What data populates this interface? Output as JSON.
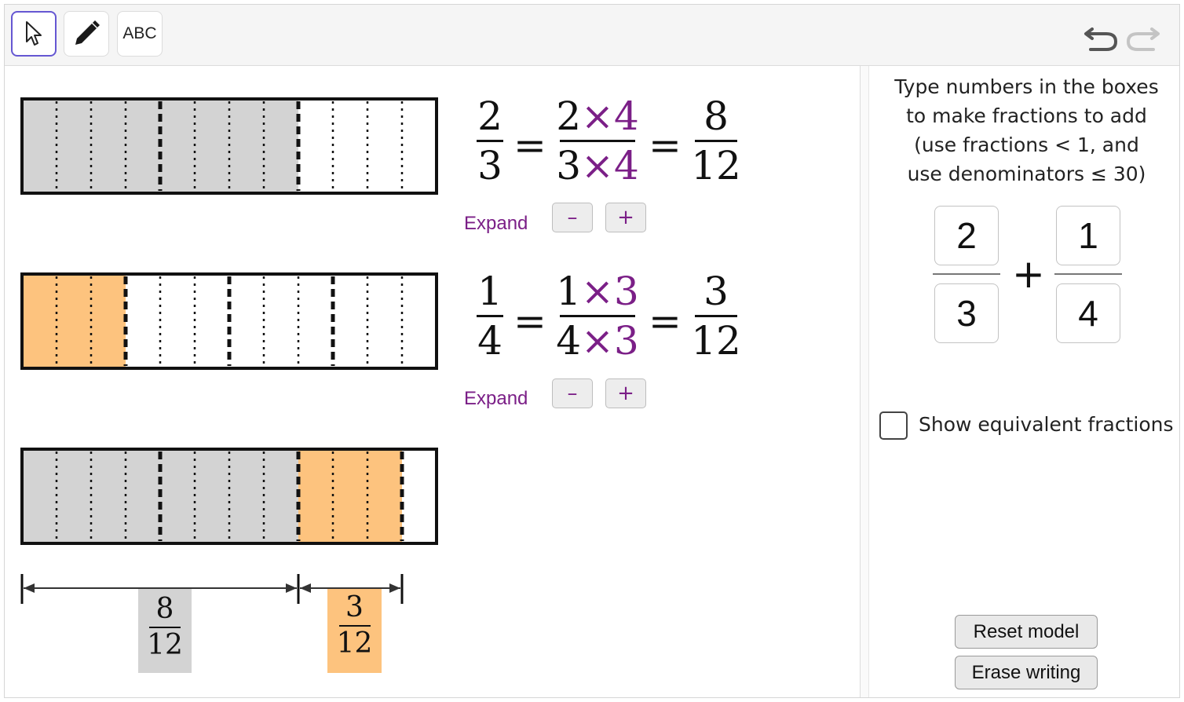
{
  "toolbar": {
    "tools": [
      {
        "icon": "arrow-cursor-icon",
        "active": true
      },
      {
        "icon": "pencil-icon",
        "active": false
      },
      {
        "text": "ABC"
      }
    ],
    "undo_icon": "undo-icon",
    "redo_icon": "redo-icon"
  },
  "model": {
    "colors": {
      "first": "#d3d3d3",
      "second": "#fdc37e",
      "accent": "#7b1f87"
    },
    "bar1": {
      "parts": 12,
      "filled": 8,
      "major_divisions": 3
    },
    "bar2": {
      "parts": 12,
      "filled": 3,
      "major_divisions": 4
    },
    "bar3": {
      "parts": 12,
      "first_filled": 8,
      "second_filled": 3
    },
    "eq1": {
      "n": "2",
      "d": "3",
      "mn": "2",
      "md": "3",
      "factor": "4",
      "times": "×",
      "rn": "8",
      "rd": "12",
      "eq": "=",
      "expand": "Expand",
      "minus": "–",
      "plus": "+"
    },
    "eq2": {
      "n": "1",
      "d": "4",
      "mn": "1",
      "md": "4",
      "factor": "3",
      "times": "×",
      "rn": "3",
      "rd": "12",
      "eq": "=",
      "expand": "Expand",
      "minus": "–",
      "plus": "+"
    },
    "label1": {
      "n": "8",
      "d": "12"
    },
    "label2": {
      "n": "3",
      "d": "12"
    }
  },
  "sidebar": {
    "instruction_lines": [
      "Type numbers in the boxes",
      "to make fractions to add",
      "(use fractions < 1, and",
      "use denominators ≤ 30)"
    ],
    "input1": {
      "numerator": "2",
      "denominator": "3"
    },
    "input2": {
      "numerator": "1",
      "denominator": "4"
    },
    "plus": "+",
    "show_equivalent": {
      "label": "Show equivalent fractions",
      "checked": false
    },
    "reset_label": "Reset model",
    "erase_label": "Erase writing"
  }
}
